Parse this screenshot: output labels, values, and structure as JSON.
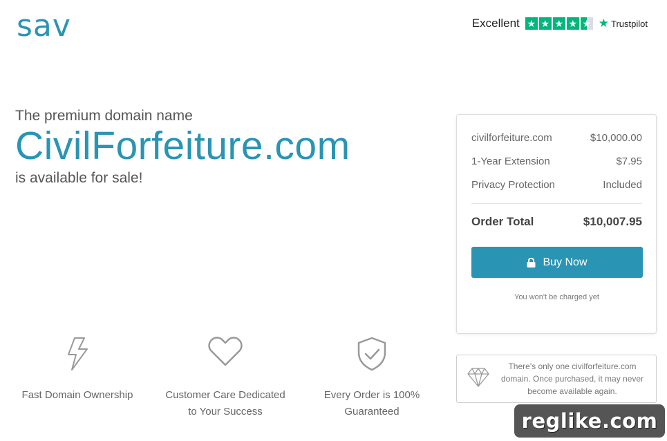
{
  "brand": {
    "logo_text": "sav",
    "accent": "#2a94b4"
  },
  "trustpilot": {
    "rating_word": "Excellent",
    "brand_name": "Trustpilot",
    "stars": 4.5,
    "star_color": "#00b67a"
  },
  "hero": {
    "pre": "The premium domain name",
    "domain": "CivilForfeiture.com",
    "post": "is available for sale!"
  },
  "order": {
    "items": [
      {
        "label": "civilforfeiture.com",
        "value": "$10,000.00"
      },
      {
        "label": "1-Year Extension",
        "value": "$7.95"
      },
      {
        "label": "Privacy Protection",
        "value": "Included"
      }
    ],
    "total_label": "Order Total",
    "total_value": "$10,007.95",
    "buy_label": "Buy Now",
    "note": "You won't be charged yet"
  },
  "uniqueness": {
    "text": "There's only one civilforfeiture.com domain. Once purchased, it may never become available again."
  },
  "features": [
    {
      "icon": "lightning-icon",
      "label": "Fast Domain Ownership"
    },
    {
      "icon": "heart-icon",
      "label": "Customer Care Dedicated to Your Success"
    },
    {
      "icon": "shield-check-icon",
      "label": "Every Order is 100% Guaranteed"
    }
  ],
  "watermark": {
    "text": "reglike.com"
  }
}
